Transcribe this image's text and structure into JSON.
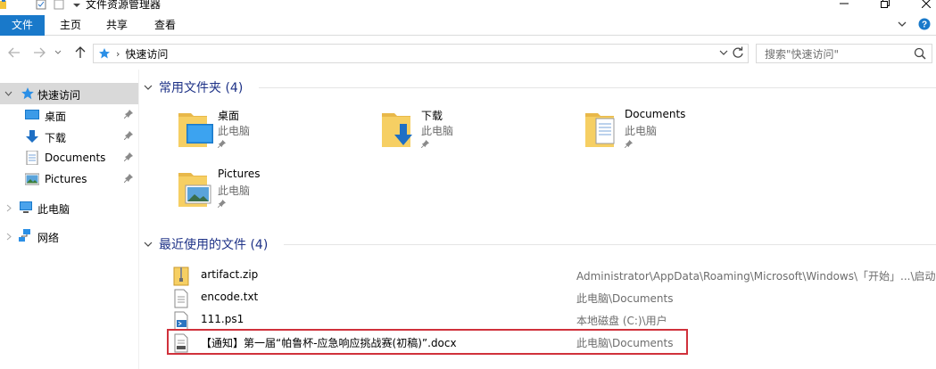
{
  "window": {
    "title": "文件资源管理器"
  },
  "ribbon": {
    "tabs": [
      "文件",
      "主页",
      "共享",
      "查看"
    ]
  },
  "address": {
    "location": "快速访问",
    "search_placeholder": "搜索\"快速访问\""
  },
  "navpane": {
    "quick_access": "快速访问",
    "pinned": [
      "桌面",
      "下载",
      "Documents",
      "Pictures"
    ],
    "this_pc": "此电脑",
    "network": "网络"
  },
  "frequent": {
    "header": "常用文件夹 (4)",
    "folders": [
      {
        "name": "桌面",
        "location": "此电脑",
        "icon": "desktop-folder-icon"
      },
      {
        "name": "下载",
        "location": "此电脑",
        "icon": "downloads-folder-icon"
      },
      {
        "name": "Documents",
        "location": "此电脑",
        "icon": "documents-folder-icon"
      },
      {
        "name": "Pictures",
        "location": "此电脑",
        "icon": "pictures-folder-icon"
      }
    ]
  },
  "recent": {
    "header": "最近使用的文件 (4)",
    "files": [
      {
        "name": "artifact.zip",
        "path": "Administrator\\AppData\\Roaming\\Microsoft\\Windows\\「开始」...\\启动",
        "icon": "zip-file-icon"
      },
      {
        "name": "encode.txt",
        "path": "此电脑\\Documents",
        "icon": "text-file-icon"
      },
      {
        "name": "111.ps1",
        "path": "本地磁盘 (C:)\\用户",
        "icon": "powershell-file-icon"
      },
      {
        "name": "【通知】第一届“帕鲁杯-应急响应挑战赛(初稿)”.docx",
        "path": "此电脑\\Documents",
        "icon": "docx-file-icon"
      }
    ]
  },
  "colors": {
    "accent": "#1979ca",
    "group_header": "#1e3287",
    "highlight_border": "#d0313b"
  }
}
